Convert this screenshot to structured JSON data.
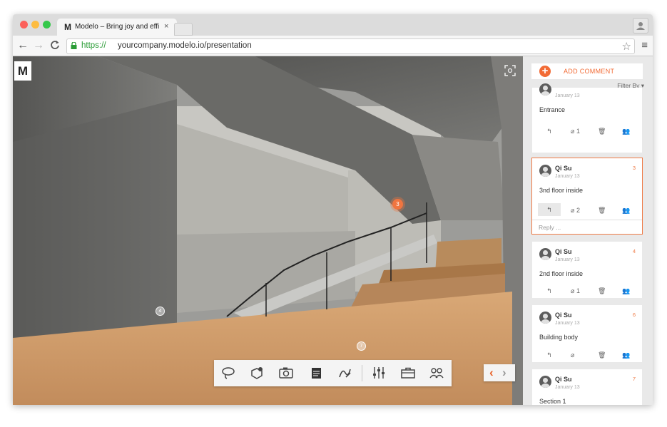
{
  "browser": {
    "tab": {
      "logo": "M",
      "title": "Modelo – Bring joy and effi",
      "close": "×"
    },
    "url": {
      "scheme": "https://",
      "rest": "yourcompany.modelo.io/presentation"
    },
    "nav": {
      "back": "←",
      "forward": "→",
      "reload": "C"
    },
    "star": "☆",
    "menu": "≡",
    "profile": "👤"
  },
  "viewer": {
    "logo": "M",
    "markers": [
      {
        "label": "3",
        "state": "active"
      },
      {
        "label": "4",
        "state": "muted"
      },
      {
        "label": "7",
        "state": "muted"
      }
    ],
    "toolbar": [
      "lasso-icon",
      "shape-icon",
      "camera-icon",
      "notes-icon",
      "sketch-icon",
      "settings-sliders-icon",
      "briefcase-icon",
      "users-icon"
    ],
    "pager": {
      "prev": "‹",
      "next": "›"
    }
  },
  "colors": {
    "accent": "#f26b35",
    "selected_border": "#ef7a45",
    "url_green": "#2a9c36"
  },
  "comments_panel": {
    "add_label": "ADD COMMENT",
    "add_plus": "+",
    "filter_label": "Filter By ▾",
    "reply_placeholder": "Reply ...",
    "comments": [
      {
        "name": "",
        "date": "January 13",
        "number": "",
        "text": "Entrance",
        "attachments": "1",
        "selected": false
      },
      {
        "name": "Qi Su",
        "date": "January 13",
        "number": "3",
        "text": "3nd floor inside",
        "attachments": "2",
        "selected": true
      },
      {
        "name": "Qi Su",
        "date": "January 13",
        "number": "4",
        "text": "2nd floor inside",
        "attachments": "1",
        "selected": false
      },
      {
        "name": "Qi Su",
        "date": "January 13",
        "number": "6",
        "text": "Building body",
        "attachments": "",
        "selected": false
      },
      {
        "name": "Qi Su",
        "date": "January 13",
        "number": "7",
        "text": "Section 1",
        "attachments": "",
        "selected": false
      }
    ]
  }
}
